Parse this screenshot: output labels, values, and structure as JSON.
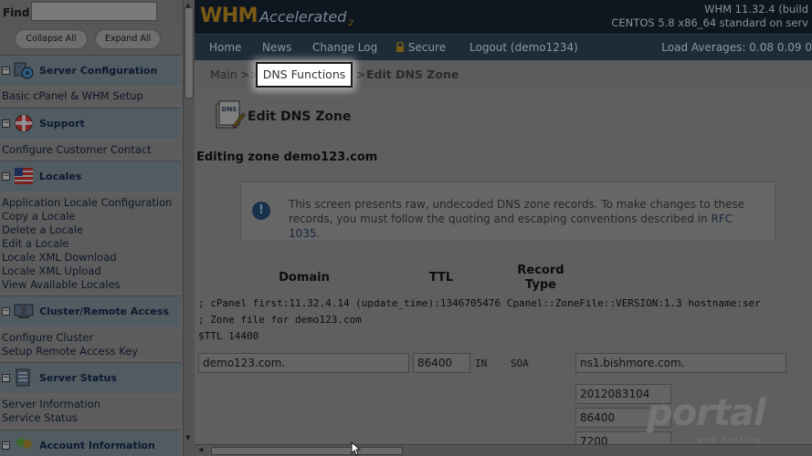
{
  "sidebar": {
    "find_label": "Find",
    "find_value": "",
    "collapse_all": "Collapse All",
    "expand_all": "Expand All",
    "sections": [
      {
        "title": "Server Configuration",
        "links": [
          "Basic cPanel & WHM Setup"
        ]
      },
      {
        "title": "Support",
        "links": [
          "Configure Customer Contact"
        ]
      },
      {
        "title": "Locales",
        "links": [
          "Application Locale Configuration",
          "Copy a Locale",
          "Delete a Locale",
          "Edit a Locale",
          "Locale XML Download",
          "Locale XML Upload",
          "View Available Locales"
        ]
      },
      {
        "title": "Cluster/Remote Access",
        "links": [
          "Configure Cluster",
          "Setup Remote Access Key"
        ]
      },
      {
        "title": "Server Status",
        "links": [
          "Server Information",
          "Service Status"
        ]
      },
      {
        "title": "Account Information",
        "links": []
      }
    ]
  },
  "header": {
    "logo_main": "WHM",
    "logo_sub": "Accelerated",
    "logo_num": "2",
    "version_line1": "WHM 11.32.4 (build",
    "version_line2": "CENTOS 5.8 x86_64 standard on serv"
  },
  "nav": {
    "items": [
      "Home",
      "News",
      "Change Log",
      "Secure",
      "Logout (demo1234)"
    ],
    "load_averages": "Load Averages: 0.08 0.09 0"
  },
  "breadcrumb": {
    "main": "Main",
    "sep1": ">>",
    "dns_functions": "DNS Functions",
    "sep2": ">",
    "current": "Edit DNS Zone"
  },
  "page": {
    "icon_label": "DNS",
    "title": "Edit DNS Zone",
    "zone_title": "Editing zone demo123.com",
    "notice_text": "This screen presents raw, undecoded DNS zone records. To make changes to these records, you must follow the quoting and escaping conventions described in",
    "notice_link": "RFC 1035",
    "notice_end": "."
  },
  "table": {
    "col_domain": "Domain",
    "col_ttl": "TTL",
    "col_record_type": "Record Type",
    "comment1": "; cPanel first:11.32.4.14 (update_time):1346705476 Cpanel::ZoneFile::VERSION:1.3 hostname:ser",
    "comment2": "; Zone file for demo123.com",
    "ttl_line": "$TTL 14400",
    "row": {
      "domain": "demo123.com.",
      "ttl": "86400",
      "class": "IN",
      "type": "SOA",
      "ns": "ns1.bishmore.com."
    },
    "soa_values": [
      "2012083104",
      "86400",
      "7200"
    ]
  },
  "watermark": {
    "main": "portal",
    "sub": "web hosting"
  }
}
